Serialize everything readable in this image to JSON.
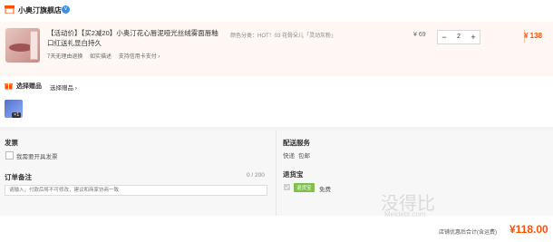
{
  "shop": {
    "name": "小奥汀旗舰店",
    "verified_icon": "v"
  },
  "item": {
    "title": "【活动价】【买2减20】小奥汀花心唇泥哑光丝绒雾面唇釉口红送礼显白持久",
    "services": [
      "7天无理由退换",
      "如实描述",
      "支持信用卡支付 ›"
    ],
    "spec": "颜色分类：HOT！03 花骨朵儿「灵动灰粉」",
    "unit_price": "¥ 69",
    "quantity": "2",
    "minus": "−",
    "plus": "+",
    "subtotal": "¥ 138"
  },
  "gift": {
    "label": "选择赠品",
    "select": "选择赠品 ›",
    "qty": "×1"
  },
  "invoice": {
    "title": "发票",
    "option": "我需要开具发票"
  },
  "remark": {
    "title": "订单备注",
    "placeholder": "请输入，付款后将不可修改，建议和商家协商一致",
    "counter": "0 / 200"
  },
  "shipping": {
    "title": "配送服务",
    "method": "快递",
    "fee": "包邮"
  },
  "return_insurance": {
    "title": "退货宝",
    "badge": "退货宝",
    "price": "免费"
  },
  "total": {
    "label": "店铺优惠后合计(含运费)",
    "value": "¥118.00"
  },
  "watermark": {
    "main": "没得比",
    "sub": "Meidebi.com"
  }
}
